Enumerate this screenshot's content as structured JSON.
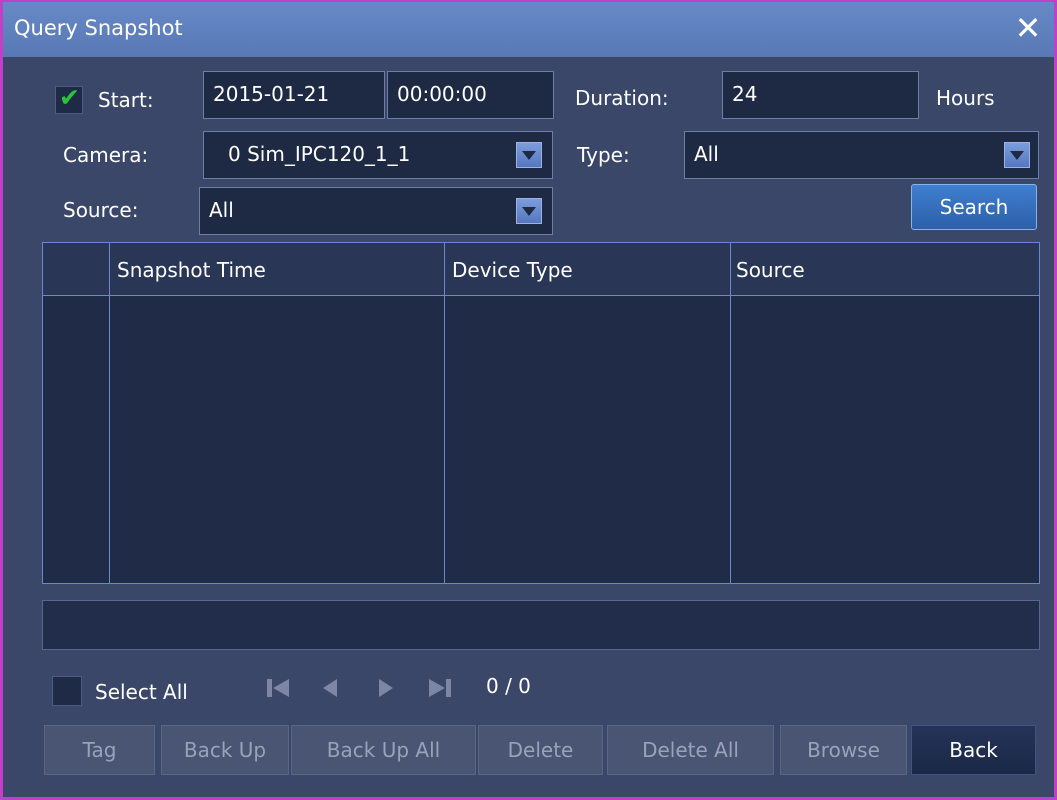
{
  "window": {
    "title": "Query Snapshot",
    "close_label": "✕"
  },
  "filters": {
    "start_label": "Start:",
    "start_checked": true,
    "start_date": "2015-01-21",
    "start_time": "00:00:00",
    "duration_label": "Duration:",
    "duration_value": "24",
    "hours_label": "Hours",
    "camera_label": "Camera:",
    "camera_value": "0  Sim_IPC120_1_1",
    "type_label": "Type:",
    "type_value": "All",
    "source_label": "Source:",
    "source_value": "All",
    "search_button": "Search"
  },
  "table": {
    "columns": [
      "Snapshot Time",
      "Device Type",
      "Source"
    ],
    "rows": []
  },
  "pagination": {
    "select_all_label": "Select  All",
    "page_text": "0 / 0"
  },
  "buttons": {
    "tag": "Tag",
    "back_up": "Back Up",
    "back_up_all": "Back Up All",
    "delete": "Delete",
    "delete_all": "Delete All",
    "browse": "Browse",
    "back": "Back"
  },
  "colors": {
    "accent": "#3f7fd0",
    "check": "#27c53a",
    "window_border": "#c23fc7"
  }
}
